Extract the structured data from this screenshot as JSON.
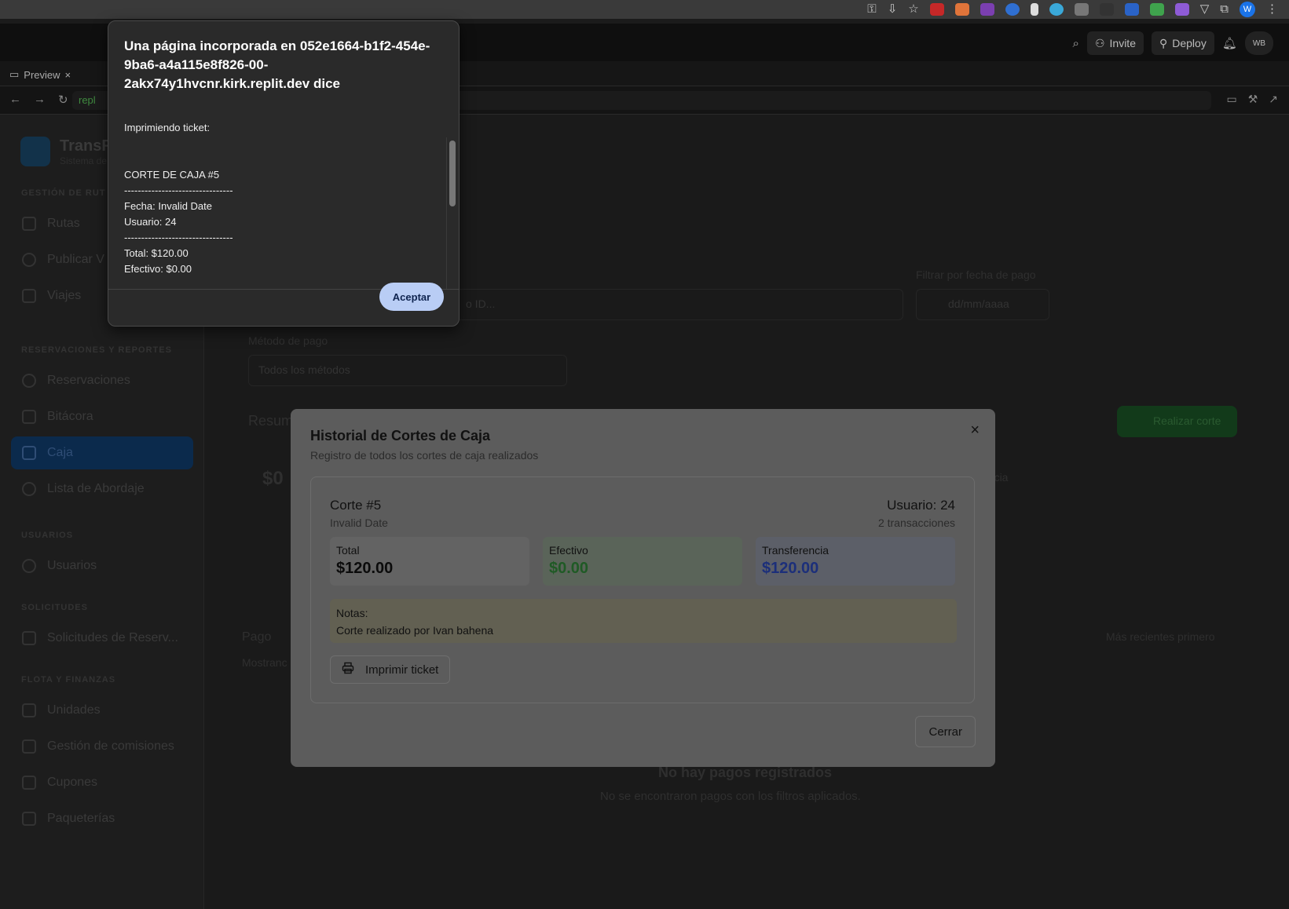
{
  "browser": {
    "tab_preview": "Preview",
    "url": "repl",
    "avatar_letter": "W"
  },
  "replit": {
    "invite": "Invite",
    "deploy": "Deploy",
    "avatar": "WB"
  },
  "app": {
    "brand_name": "TransR",
    "brand_sub": "Sistema de",
    "sections": {
      "rutas": "GESTIÓN DE RUT",
      "reservaciones": "RESERVACIONES Y REPORTES",
      "usuarios": "USUARIOS",
      "solicitudes": "SOLICITUDES",
      "flota": "FLOTA Y FINANZAS"
    },
    "nav": {
      "rutas": "Rutas",
      "publicar": "Publicar V",
      "viajes": "Viajes",
      "reservaciones": "Reservaciones",
      "bitacora": "Bitácora",
      "caja": "Caja",
      "abordaje": "Lista de Abordaje",
      "usuarios": "Usuarios",
      "solicitudes": "Solicitudes de Reserv...",
      "unidades": "Unidades",
      "comisiones": "Gestión de comisiones",
      "cupones": "Cupones",
      "paqueterias": "Paqueterías"
    },
    "main": {
      "filter_date_label": "Filtrar por fecha de pago",
      "date_placeholder": "dd/mm/aaaa",
      "search_partial": "o ID...",
      "method_label": "Método de pago",
      "method_value": "Todos los métodos",
      "resumen": "Resum",
      "realizar_corte": "Realizar corte",
      "total_partial": "T",
      "amount_partial": "$0",
      "transferencia_partial": "encia",
      "pagos_partial": "Pago",
      "mostrando_partial": "Mostranc",
      "sort": "Más recientes primero",
      "empty_title": "No hay pagos registrados",
      "empty_sub": "No se encontraron pagos con los filtros aplicados."
    }
  },
  "modal": {
    "title": "Historial de Cortes de Caja",
    "subtitle": "Registro de todos los cortes de caja realizados",
    "corte": {
      "title": "Corte #5",
      "date": "Invalid Date",
      "user": "Usuario: 24",
      "transactions": "2 transacciones",
      "total_label": "Total",
      "total_value": "$120.00",
      "cash_label": "Efectivo",
      "cash_value": "$0.00",
      "transfer_label": "Transferencia",
      "transfer_value": "$120.00",
      "notes_label": "Notas:",
      "notes_text": "Corte realizado por Ivan bahena",
      "print_label": "Imprimir ticket"
    },
    "close_label": "Cerrar",
    "colors": {
      "cash": "#1f5a25",
      "transfer": "#1c2f7a"
    }
  },
  "alert": {
    "title": "Una página incorporada en 052e1664-b1f2-454e-9ba6-a4a115e8f826-00-2akx74y1hvcnr.kirk.replit.dev dice",
    "body": "Imprimiendo ticket:\n\n\nCORTE DE CAJA #5\n--------------------------------\nFecha: Invalid Date\nUsuario: 24\n--------------------------------\nTotal: $120.00\nEfectivo: $0.00",
    "ok_label": "Aceptar"
  }
}
